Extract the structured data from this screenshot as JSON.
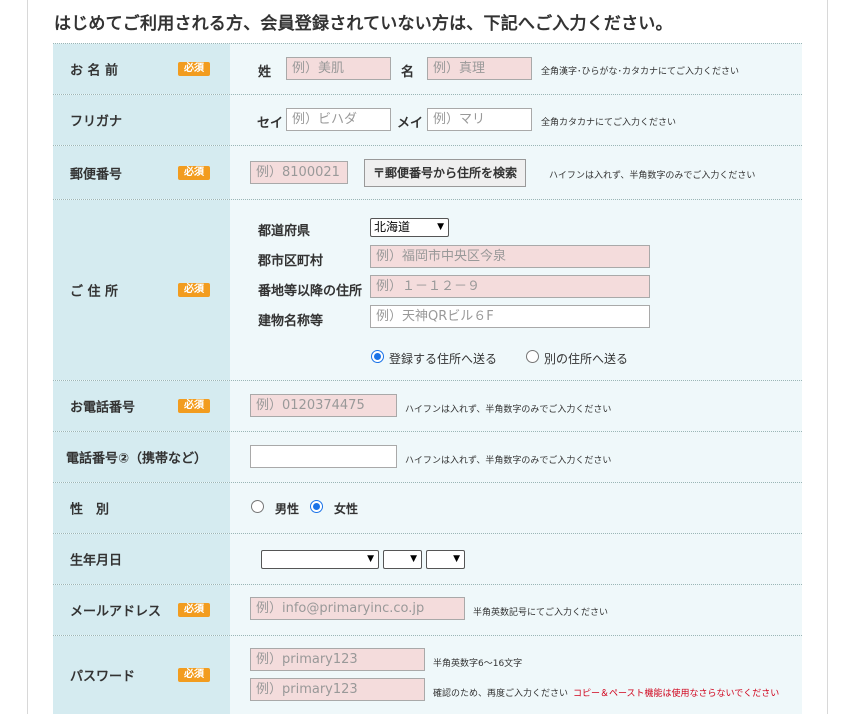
{
  "heading": "はじめてご利用される方、会員登録されていない方は、下記へご入力ください。",
  "required_badge": "必須",
  "name": {
    "label": "お 名 前",
    "sei_label": "姓",
    "sei_placeholder": "例）美肌",
    "mei_label": "名",
    "mei_placeholder": "例）真理",
    "note": "全角漢字･ひらがな･カタカナにてご入力ください"
  },
  "furigana": {
    "label": "フリガナ",
    "sei_label": "セイ",
    "sei_placeholder": "例）ビハダ",
    "mei_label": "メイ",
    "mei_placeholder": "例）マリ",
    "note": "全角カタカナにてご入力ください"
  },
  "postal": {
    "label": "郵便番号",
    "placeholder": "例）8100021",
    "search_button": "〒郵便番号から住所を検索",
    "note": "ハイフンは入れず、半角数字のみでご入力ください"
  },
  "address": {
    "label": "ご 住 所",
    "prefecture_label": "都道府県",
    "prefecture_value": "北海道",
    "city_label": "郡市区町村",
    "city_placeholder": "例）福岡市中央区今泉",
    "street_label": "番地等以降の住所",
    "street_placeholder": "例）１－１２－９",
    "building_label": "建物名称等",
    "building_placeholder": "例）天神QRビル６F",
    "ship_registered": "登録する住所へ送る",
    "ship_other": "別の住所へ送る"
  },
  "phone": {
    "label": "お電話番号",
    "placeholder": "例）0120374475",
    "note": "ハイフンは入れず、半角数字のみでご入力ください"
  },
  "phone2": {
    "label": "電話番号②（携帯など）",
    "note": "ハイフンは入れず、半角数字のみでご入力ください"
  },
  "gender": {
    "label": "性　別",
    "male": "男性",
    "female": "女性",
    "selected": "female"
  },
  "birthday": {
    "label": "生年月日"
  },
  "email": {
    "label": "メールアドレス",
    "placeholder": "例）info@primaryinc.co.jp",
    "note": "半角英数記号にてご入力ください"
  },
  "password": {
    "label": "パスワード",
    "placeholder": "例）primary123",
    "confirm_placeholder": "例）primary123",
    "note": "半角英数字6～16文字",
    "confirm_note": "確認のため、再度ご入力ください",
    "warning": "コピー＆ペースト機能は使用なさらないでください"
  }
}
